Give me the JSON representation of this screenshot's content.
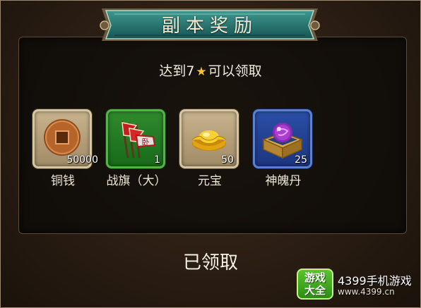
{
  "dialog": {
    "title": "副本奖励",
    "condition_prefix": "达到7",
    "condition_suffix": "可以领取",
    "status": "已领取"
  },
  "rewards": [
    {
      "name": "铜钱",
      "count": "50000",
      "icon": "copper-coin-icon",
      "frame": "tan"
    },
    {
      "name": "战旗（大）",
      "count": "1",
      "icon": "war-flag-icon",
      "frame": "green"
    },
    {
      "name": "元宝",
      "count": "50",
      "icon": "gold-ingot-icon",
      "frame": "tan"
    },
    {
      "name": "神魄丹",
      "count": "25",
      "icon": "spirit-pill-icon",
      "frame": "blue"
    }
  ],
  "watermark": {
    "logo_top": "游戏",
    "logo_bottom": "大全",
    "brand": "4399手机游戏",
    "url": "www.4399.cn"
  },
  "colors": {
    "banner": "#1f6b6b",
    "star": "#f3c532",
    "frame_green": "#2f8a2c",
    "frame_blue": "#2b4ea6",
    "frame_tan": "#c8b38e"
  }
}
